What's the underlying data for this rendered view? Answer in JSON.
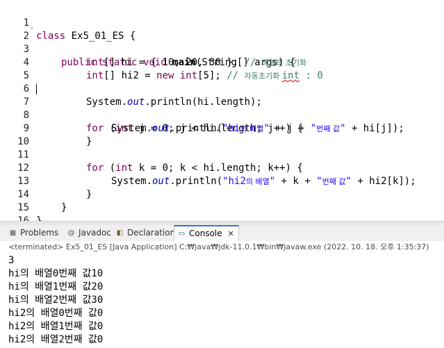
{
  "editor": {
    "lines": [
      {
        "n": "1"
      },
      {
        "n": "2"
      },
      {
        "n": "3"
      },
      {
        "n": "4"
      },
      {
        "n": "5"
      },
      {
        "n": "6"
      },
      {
        "n": "7"
      },
      {
        "n": "8"
      },
      {
        "n": "9"
      },
      {
        "n": "10"
      },
      {
        "n": "11"
      },
      {
        "n": "12"
      },
      {
        "n": "13"
      },
      {
        "n": "14"
      },
      {
        "n": "15"
      },
      {
        "n": "16"
      }
    ],
    "t": {
      "class": "class",
      "class_name": " Ex5_01_ES {",
      "public": "public",
      "static": "static",
      "void": "void",
      "main": "main",
      "main_args": "(String[] args) {",
      "int_arr1": "int",
      "hi_decl": "[] hi = { ",
      "n10": "10",
      "comma1": ", ",
      "n20": "20",
      "comma2": ", ",
      "n30": "30",
      "close_brace_semi": " }; ",
      "cmt3_a": "// ",
      "cmt3_b": "배열의 초기화",
      "int_arr2": "int",
      "hi2_decl": "[] hi2 = ",
      "new": "new",
      "int_new": " int",
      "size": "[5]; ",
      "cmt4_a": "// ",
      "cmt4_b": "자동초기화 ",
      "cmt4_c": "int",
      "cmt4_d": " : 0",
      "sys1_a": "System.",
      "out": "out",
      "sys1_b": ".println(hi.length);",
      "for1": "for",
      "for1_b": " (",
      "int_j": "int",
      "for1_c": " j = 0; j < hi.length; j++) {",
      "sys2_a": "System.",
      "sys2_b": ".println(",
      "str_hi_a": "\"hi",
      "str_hi_b": "의 배열",
      "str_hi_c": "\"",
      "plus_j": " + j + ",
      "str_q1": "\"",
      "str_bun": "번째 값",
      "str_q2": "\"",
      "tail1": " + hi[j]);",
      "close_b": "}",
      "for2": "for",
      "for2_b": " (",
      "int_k": "int",
      "for2_c": " k = 0; k < hi.length; k++) {",
      "str_hi2_a": "\"hi2",
      "str_hi2_b": "의 배열",
      "plus_k": " + k + ",
      "tail2": " + hi2[k]);",
      "close_c": "}",
      "close_d": "}",
      "close_e": "}"
    }
  },
  "tabs": [
    {
      "label": "Problems",
      "icon": "problems-icon"
    },
    {
      "label": "Javadoc",
      "icon": "javadoc-icon"
    },
    {
      "label": "Declaration",
      "icon": "declaration-icon"
    },
    {
      "label": "Console",
      "icon": "console-icon"
    }
  ],
  "status": "<terminated> Ex5_01_ES [Java Application] C:₩java₩jdk-11.0.1₩bin₩javaw.exe  (2022. 10. 18. 오후 1:35:37)",
  "console_output": [
    "3",
    "hi의 배열0번째 값10",
    "hi의 배열1번째 값20",
    "hi의 배열2번째 값30",
    "hi2의 배열0번째 값0",
    "hi2의 배열1번째 값0",
    "hi2의 배열2번째 값0"
  ],
  "colors": {
    "keyword": "#7f0055",
    "string": "#2a00ff",
    "comment": "#3f7f5f",
    "field": "#0000c0",
    "active_tab_border": "#3875d6"
  }
}
